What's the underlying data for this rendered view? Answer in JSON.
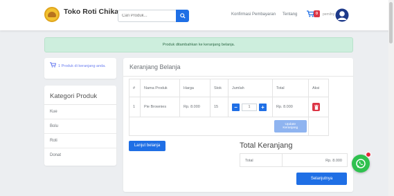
{
  "navbar": {
    "brand": "Toko Roti Chika",
    "search_placeholder": "Cari Produk...",
    "links": [
      "Konfirmasi Pembayaran",
      "Tentang"
    ],
    "cart_count": "0",
    "username": "pemilny",
    "icons": {
      "search": "search-icon",
      "cart": "cart-icon",
      "avatar": "user-avatar-icon"
    }
  },
  "alert": {
    "message": "Produk ditambahkan ke keranjang belanja."
  },
  "cart_summary": {
    "text": "1 Produk di keranjang anda."
  },
  "categories": {
    "title": "Kategori Produk",
    "items": [
      "Kue",
      "Bolu",
      "Roti",
      "Donat"
    ]
  },
  "cart": {
    "title": "Keranjang Belanja",
    "columns": [
      "#",
      "Nama Produk",
      "Harga",
      "Stok",
      "Jumlah",
      "Total",
      "Aksi"
    ],
    "rows": [
      {
        "no": "1",
        "name": "Pie Brownies",
        "price": "Rp. 8.000",
        "stock": "15",
        "qty": "1",
        "total": "Rp. 8.000"
      }
    ],
    "update_label": "Update Keranjang"
  },
  "actions": {
    "continue_label": "Lanjut belanja",
    "next_label": "Selanjutnya"
  },
  "totals": {
    "title": "Total Keranjang",
    "label": "Total",
    "value": "Rp. 8.000"
  },
  "colors": {
    "primary": "#1f6fe5",
    "danger": "#dc3545",
    "alert_bg": "#cdeedd",
    "whatsapp": "#2fc14f"
  }
}
